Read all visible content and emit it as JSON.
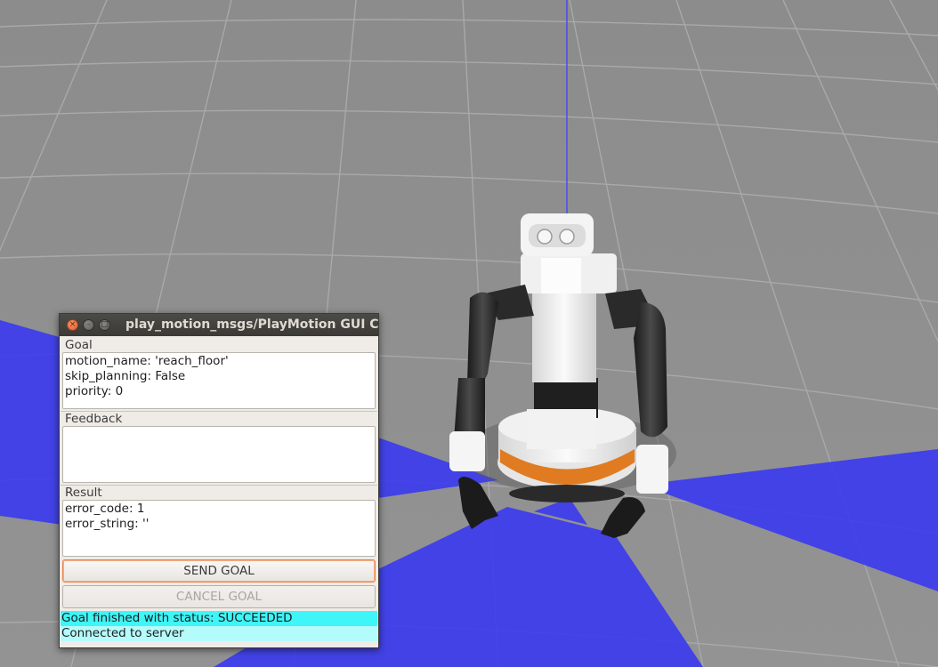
{
  "window": {
    "title": "play_motion_msgs/PlayMotion GUI Cli",
    "controls": {
      "close": "×",
      "minimize": "–",
      "maximize": "□"
    }
  },
  "goal": {
    "label": "Goal",
    "lines": [
      "motion_name: 'reach_floor'",
      "skip_planning: False",
      "priority: 0"
    ]
  },
  "feedback": {
    "label": "Feedback",
    "lines": []
  },
  "result": {
    "label": "Result",
    "lines": [
      "error_code: 1",
      "error_string: ''"
    ]
  },
  "buttons": {
    "send": "SEND GOAL",
    "cancel": "CANCEL GOAL"
  },
  "status": {
    "line1": "Goal finished with status: SUCCEEDED",
    "line2": "Connected to server"
  },
  "colors": {
    "status_active": "#3ef5f7",
    "status_info": "#b4fbfc",
    "laser": "#3a3af0",
    "close_button": "#e45c2a"
  }
}
